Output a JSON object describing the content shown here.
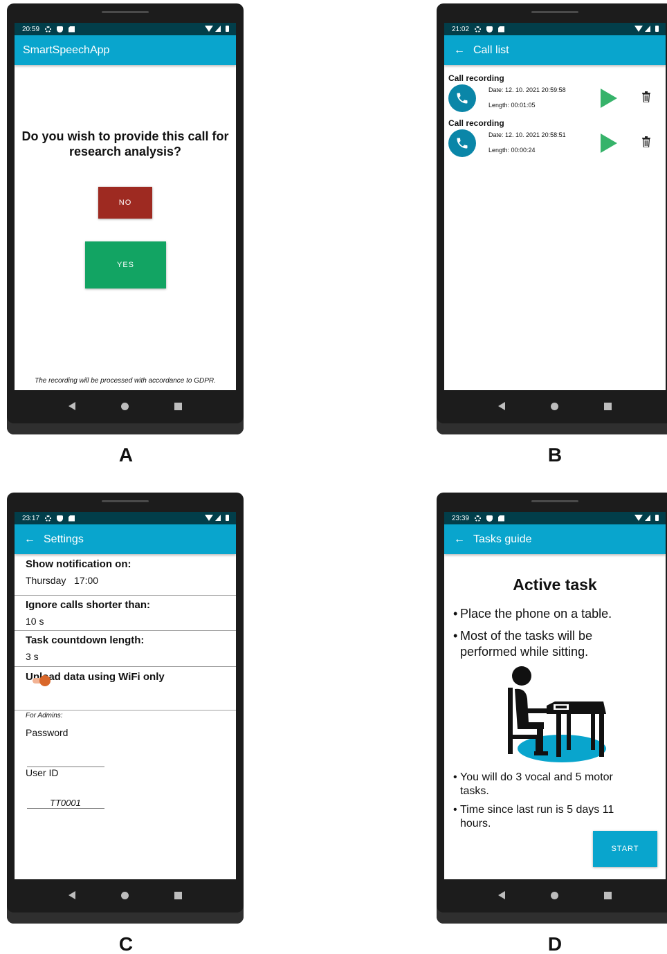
{
  "panels": {
    "a": {
      "letter": "A",
      "status_time": "20:59",
      "app_title": "SmartSpeechApp",
      "question": "Do you wish to provide this call for research analysis?",
      "no_label": "NO",
      "yes_label": "YES",
      "footer": "The recording will be processed with accordance to GDPR."
    },
    "b": {
      "letter": "B",
      "status_time": "21:02",
      "title": "Call list",
      "recordings": [
        {
          "title": "Call recording",
          "date": "Date: 12. 10. 2021 20:59:58",
          "length": "Length: 00:01:05"
        },
        {
          "title": "Call recording",
          "date": "Date: 12. 10. 2021 20:58:51",
          "length": "Length: 00:00:24"
        }
      ]
    },
    "c": {
      "letter": "C",
      "status_time": "23:17",
      "title": "Settings",
      "notification_label": "Show notification on:",
      "notification_value": "Thursday   17:00",
      "ignore_label": "Ignore calls shorter than:",
      "ignore_value": "10 s",
      "countdown_label": "Task countdown length:",
      "countdown_value": "3 s",
      "wifi_label": "Upload data using WiFi only",
      "wifi_only_enabled": true,
      "admins_label": "For Admins:",
      "password_label": "Password",
      "password_value": "",
      "userid_label": "User ID",
      "userid_value": "TT0001"
    },
    "d": {
      "letter": "D",
      "status_time": "23:39",
      "title": "Tasks guide",
      "heading": "Active task",
      "bullet1": "Place the phone on a table.",
      "bullet2": "Most of the tasks will be performed while sitting.",
      "bullet3": "You will do 3 vocal and 5 motor tasks.",
      "bullet4": "Time since last run is 5 days 11 hours.",
      "start_label": "START"
    }
  },
  "colors": {
    "status_bar": "#023e4a",
    "app_bar": "#09a5cd",
    "no_button": "#9e2a21",
    "yes_button": "#12a463",
    "play_icon": "#36b36a",
    "toggle_on": "#d9672a"
  },
  "icons": [
    "back-arrow-icon",
    "phone-icon",
    "play-icon",
    "trash-icon",
    "settings-gear-icon",
    "shield-icon",
    "sd-card-icon",
    "wifi-icon",
    "signal-icon",
    "battery-icon"
  ]
}
